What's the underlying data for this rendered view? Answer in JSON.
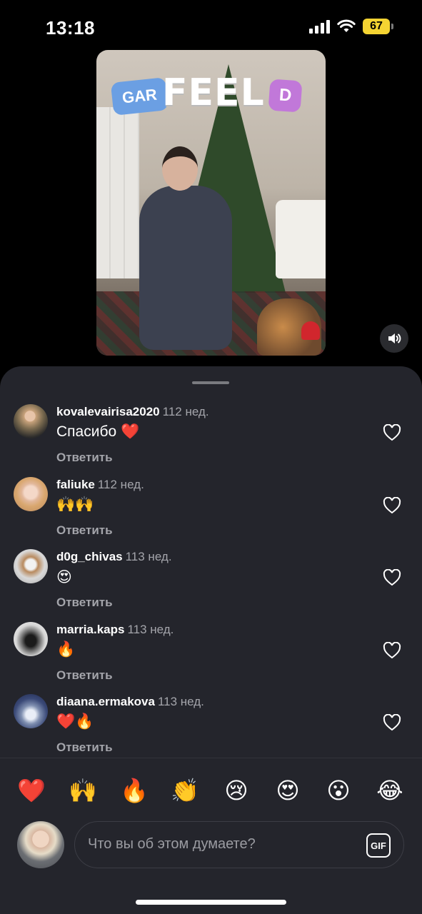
{
  "status_bar": {
    "time": "13:18",
    "battery": "67"
  },
  "video": {
    "logo_left": "GAR",
    "logo_main": "FEEL",
    "logo_right": "D"
  },
  "comments": [
    {
      "username": "kovalevairisa2020",
      "time": "112 нед.",
      "text": "Спасибо ❤️",
      "reply": "Ответить"
    },
    {
      "username": "faliuke",
      "time": "112 нед.",
      "text": "🙌🙌",
      "reply": "Ответить"
    },
    {
      "username": "d0g_chivas",
      "time": "113 нед.",
      "text": "😍",
      "reply": "Ответить"
    },
    {
      "username": "marria.kaps",
      "time": "113 нед.",
      "text": "🔥",
      "reply": "Ответить"
    },
    {
      "username": "diaana.ermakova",
      "time": "113 нед.",
      "text": "❤️🔥",
      "reply": "Ответить"
    }
  ],
  "quick_reactions": [
    "❤️",
    "🙌",
    "🔥",
    "👏",
    "😢",
    "😍",
    "😮",
    "😂"
  ],
  "composer": {
    "placeholder": "Что вы об этом думаете?",
    "gif_label": "GIF"
  },
  "colors": {
    "sheet_bg": "#24252c",
    "secondary_text": "#a4a5ab",
    "battery": "#f5d432"
  }
}
